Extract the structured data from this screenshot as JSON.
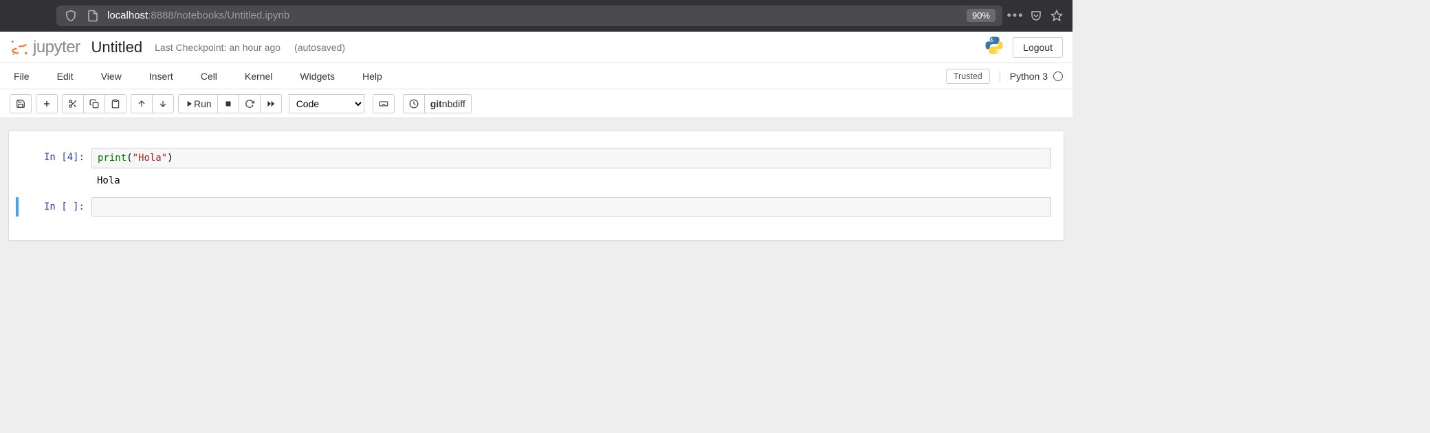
{
  "browser": {
    "url_host": "localhost",
    "url_port_path": ":8888/notebooks/Untitled.ipynb",
    "zoom": "90%"
  },
  "header": {
    "logo_text": "jupyter",
    "notebook_name": "Untitled",
    "checkpoint": "Last Checkpoint: an hour ago",
    "autosave": "(autosaved)",
    "logout": "Logout"
  },
  "menu": {
    "items": [
      "File",
      "Edit",
      "View",
      "Insert",
      "Cell",
      "Kernel",
      "Widgets",
      "Help"
    ],
    "trusted": "Trusted",
    "kernel": "Python 3"
  },
  "toolbar": {
    "run_label": " Run",
    "cell_type": "Code",
    "git_label_bold": "git",
    "git_label_rest": " nbdiff"
  },
  "cells": [
    {
      "prompt": "In [4]:",
      "code_func": "print",
      "code_open": "(",
      "code_str": "\"Hola\"",
      "code_close": ")",
      "output": "Hola"
    },
    {
      "prompt": "In [ ]:",
      "code": ""
    }
  ]
}
